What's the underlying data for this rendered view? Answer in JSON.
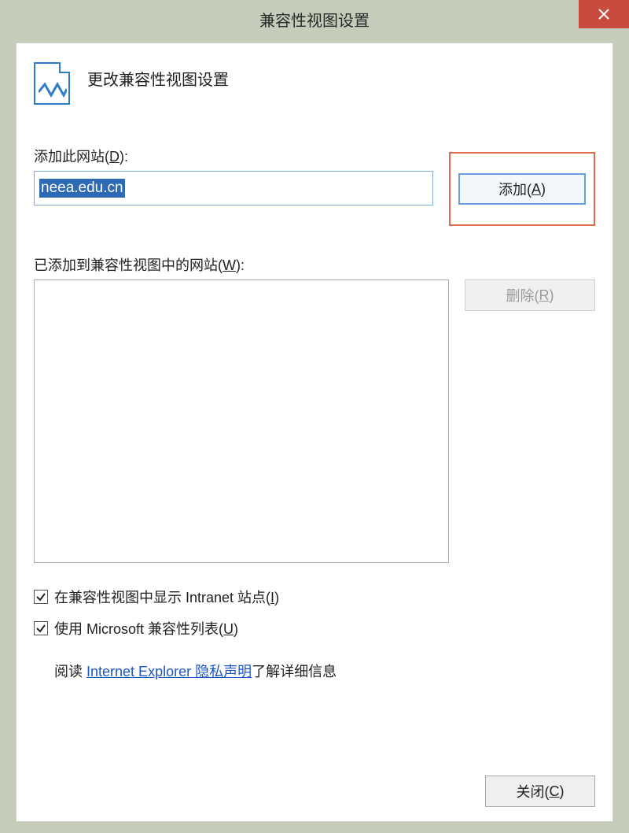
{
  "window": {
    "title": "兼容性视图设置"
  },
  "header": {
    "subtitle": "更改兼容性视图设置"
  },
  "add_section": {
    "label_prefix": "添加此网站(",
    "label_hotkey": "D",
    "label_suffix": "):",
    "input_value": "neea.edu.cn",
    "add_btn_prefix": "添加(",
    "add_btn_hotkey": "A",
    "add_btn_suffix": ")"
  },
  "list_section": {
    "label_prefix": "已添加到兼容性视图中的网站(",
    "label_hotkey": "W",
    "label_suffix": "):",
    "remove_btn_prefix": "删除(",
    "remove_btn_hotkey": "R",
    "remove_btn_suffix": ")"
  },
  "options": {
    "intranet_prefix": "在兼容性视图中显示 Intranet 站点(",
    "intranet_hotkey": "I",
    "intranet_suffix": ")",
    "intranet_checked": true,
    "mslist_prefix": "使用 Microsoft 兼容性列表(",
    "mslist_hotkey": "U",
    "mslist_suffix": ")",
    "mslist_checked": true
  },
  "info": {
    "prefix": "阅读 ",
    "link_text": "Internet Explorer 隐私声明",
    "suffix": "了解详细信息"
  },
  "footer": {
    "close_prefix": "关闭(",
    "close_hotkey": "C",
    "close_suffix": ")"
  }
}
